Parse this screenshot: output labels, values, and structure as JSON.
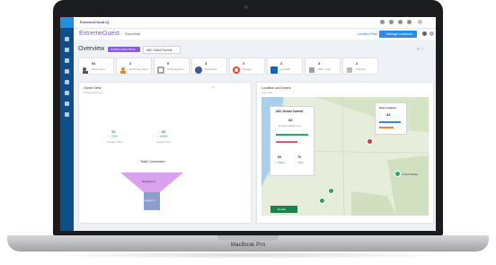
{
  "device": {
    "brand_label": "MacBook Pro"
  },
  "app": {
    "topbar_title": "ExtremeCloud IQ",
    "brand_primary": "ExtremeGuest",
    "brand_secondary": "Essentials",
    "location_link": "Location Filter",
    "primary_button": "Manage Locations",
    "page_title": "Overview",
    "filter_pill": "GUEST ANALYTICS",
    "filter_select": "ABC Global Summit"
  },
  "cards": [
    {
      "icon": "users-icon",
      "value": "51",
      "label": "Total Users"
    },
    {
      "icon": "returning-users-icon",
      "value": "2",
      "label": "Returning Users"
    },
    {
      "icon": "device-icon",
      "value": "0",
      "label": "Total Devices"
    },
    {
      "icon": "facebook-icon",
      "value": "3",
      "label": "Facebook"
    },
    {
      "icon": "google-icon",
      "value": "2",
      "label": "Google"
    },
    {
      "icon": "linkedin-icon",
      "value": "2",
      "label": "LinkedIn"
    },
    {
      "icon": "puzzle-icon",
      "value": "2",
      "label": "Web Login"
    },
    {
      "icon": "puzzle-icon-2",
      "value": "2",
      "label": "Voucher"
    }
  ],
  "left_panel": {
    "title": "Guest View",
    "subtitle": "Connected now",
    "stat_a_value": "33",
    "stat_a_change": "↑ 70%",
    "stat_a_label": "Guests Online",
    "stat_b_value": "60",
    "stat_b_change": "↑ 400%",
    "stat_b_label": "Guests Visits",
    "funnel_title": "Total Connected",
    "funnel_top_label": "Registered",
    "funnel_bottom_label": "Logged In"
  },
  "right_panel": {
    "title": "Location and Users",
    "subtitle": "Live map",
    "card_title": "ABC Global Summit",
    "card_value": "33",
    "card_label": "Guests online now",
    "card_stat1_value": "60",
    "card_stat1_change": "↑ 400%",
    "card_stat2_value": "70",
    "card_stat2_change": "↑ 70%",
    "site_title": "Site Location",
    "site_value": "33",
    "pin_label": "United States",
    "bottom_button": "Details"
  },
  "colors": {
    "sidebar": "#0e4f8a",
    "accent": "#7a5bd0",
    "primary": "#2a8de6",
    "funnel": "#c98de8",
    "map_green": "#2ba36b",
    "pin_red": "#d8323a"
  }
}
